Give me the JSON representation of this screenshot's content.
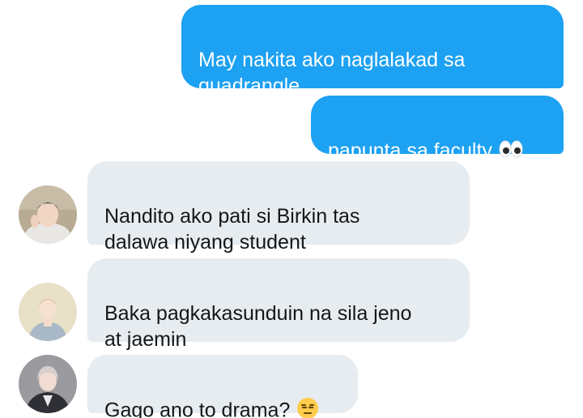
{
  "messages": [
    {
      "side": "sent",
      "text": "May nakita ako naglalakad sa\nquadrangle"
    },
    {
      "side": "sent",
      "text": "papunta sa faculty",
      "emoji": "eyes-emoji"
    },
    {
      "side": "received",
      "text": "Nandito ako pati si Birkin tas\ndalawa niyang student",
      "avatar": "user-avatar-photo"
    },
    {
      "side": "received",
      "text": "Baka pagkakasunduin na sila jeno\nat jaemin",
      "avatar": "user-avatar-photo"
    },
    {
      "side": "received",
      "text": "Gago ano to drama?",
      "emoji": "expressionless-face-emoji",
      "avatar": "user-avatar-photo"
    }
  ],
  "colors": {
    "sent_bubble": "#1da1f2",
    "received_bubble": "#e6ecf0",
    "received_text": "#14171a"
  }
}
